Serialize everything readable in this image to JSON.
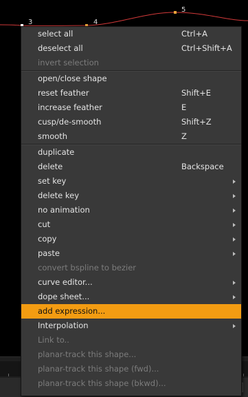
{
  "viewer": {
    "curve_color": "#d33a3a",
    "point_color": "#e8a33a",
    "point_labels": [
      "3",
      "4",
      "5"
    ]
  },
  "menu": {
    "highlight_color": "#f39c12",
    "sections": [
      [
        {
          "label": "select all",
          "shortcut": "Ctrl+A"
        },
        {
          "label": "deselect all",
          "shortcut": "Ctrl+Shift+A"
        },
        {
          "label": "invert selection",
          "disabled": true
        }
      ],
      [
        {
          "label": "open/close shape"
        },
        {
          "label": "reset feather",
          "shortcut": "Shift+E"
        },
        {
          "label": "increase feather",
          "shortcut": "E"
        },
        {
          "label": "cusp/de-smooth",
          "shortcut": "Shift+Z"
        },
        {
          "label": "smooth",
          "shortcut": "Z"
        }
      ],
      [
        {
          "label": "duplicate"
        },
        {
          "label": "delete",
          "shortcut": "Backspace"
        },
        {
          "label": "set key",
          "submenu": true
        },
        {
          "label": "delete key",
          "submenu": true
        },
        {
          "label": "no animation",
          "submenu": true
        },
        {
          "label": "cut",
          "submenu": true
        },
        {
          "label": "copy",
          "submenu": true
        },
        {
          "label": "paste",
          "submenu": true
        },
        {
          "label": "convert bspline to bezier",
          "disabled": true
        },
        {
          "label": "curve editor...",
          "submenu": true
        },
        {
          "label": "dope sheet...",
          "submenu": true
        },
        {
          "label": "add expression...",
          "highlighted": true
        },
        {
          "label": "Interpolation",
          "submenu": true
        },
        {
          "label": "Link to..",
          "disabled": true
        },
        {
          "label": "planar-track this shape...",
          "disabled": true
        },
        {
          "label": "planar-track this shape (fwd)...",
          "disabled": true
        },
        {
          "label": "planar-track this shape (bkwd)...",
          "disabled": true
        }
      ]
    ]
  }
}
